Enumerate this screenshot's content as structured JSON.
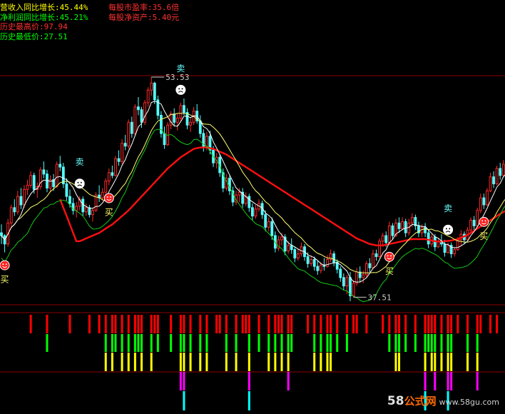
{
  "info_lines": [
    {
      "text": "营收入同比增长:45.44%",
      "color": "#ffff00"
    },
    {
      "text": "净利润同比增长:45.21%",
      "color": "#00ff00"
    },
    {
      "text": "历史最高价:97.94",
      "color": "#ff3030"
    },
    {
      "text": "历史最低价:27.51",
      "color": "#00ff00"
    }
  ],
  "info_right": [
    {
      "text": "每股市盈率:35.6倍",
      "color": "#ff3030"
    },
    {
      "text": "每股净资产:5.40元",
      "color": "#ff3030"
    }
  ],
  "watermark": {
    "num": "58",
    "cn": "公式网",
    "domain": "www.58gu.com"
  },
  "colors": {
    "bg": "#000000",
    "up": "#ff2a2a",
    "down": "#54ffff",
    "ma_red": "#ff1010",
    "ma_yellow": "#ffff6e",
    "ma_white": "#ffffff",
    "ma_green": "#14c814",
    "sep": "#8b0000",
    "bar_red": "#ff0000",
    "bar_green": "#00ff00",
    "bar_yellow": "#ffff00",
    "bar_magenta": "#ff00ff",
    "bar_cyan": "#00ffff"
  },
  "chart_data": {
    "type": "candlestick",
    "price_range": [
      37.51,
      53.53
    ],
    "annotations": [
      {
        "label": "53.53",
        "kind": "high",
        "index": 46
      },
      {
        "label": "37.51",
        "kind": "low",
        "index": 108
      }
    ],
    "signals": [
      {
        "label": "买",
        "type": "buy",
        "index": 1
      },
      {
        "label": "卖",
        "type": "sell",
        "index": 24
      },
      {
        "label": "买",
        "type": "buy",
        "index": 33
      },
      {
        "label": "卖",
        "type": "sell",
        "index": 55
      },
      {
        "label": "买",
        "type": "buy",
        "index": 119
      },
      {
        "label": "卖",
        "type": "sell",
        "index": 137
      },
      {
        "label": "买",
        "type": "buy",
        "index": 148
      }
    ],
    "candles": [
      [
        42.4,
        43.0,
        41.6,
        42.2
      ],
      [
        42.2,
        42.3,
        41.0,
        41.6
      ],
      [
        41.6,
        43.4,
        41.4,
        43.1
      ],
      [
        43.1,
        44.4,
        42.8,
        44.2
      ],
      [
        44.2,
        44.8,
        43.6,
        43.9
      ],
      [
        43.9,
        45.4,
        43.7,
        45.0
      ],
      [
        45.0,
        45.6,
        44.1,
        44.4
      ],
      [
        44.4,
        45.8,
        44.2,
        45.5
      ],
      [
        45.5,
        46.2,
        45.1,
        45.8
      ],
      [
        45.8,
        46.8,
        45.6,
        46.5
      ],
      [
        46.5,
        46.7,
        45.2,
        45.5
      ],
      [
        45.5,
        46.0,
        44.9,
        45.7
      ],
      [
        45.7,
        47.1,
        45.5,
        46.9
      ],
      [
        46.9,
        47.5,
        46.3,
        46.6
      ],
      [
        46.6,
        46.9,
        45.3,
        45.6
      ],
      [
        45.6,
        46.5,
        45.3,
        46.2
      ],
      [
        46.2,
        46.6,
        45.4,
        45.7
      ],
      [
        45.7,
        47.5,
        45.6,
        47.3
      ],
      [
        47.3,
        47.9,
        46.8,
        47.1
      ],
      [
        47.1,
        47.4,
        45.6,
        45.9
      ],
      [
        45.9,
        46.3,
        44.7,
        45.0
      ],
      [
        45.0,
        45.5,
        44.2,
        44.5
      ],
      [
        44.5,
        44.9,
        43.7,
        44.0
      ],
      [
        44.0,
        44.6,
        43.5,
        44.3
      ],
      [
        44.3,
        45.0,
        44.0,
        44.8
      ],
      [
        44.8,
        45.0,
        43.6,
        43.9
      ],
      [
        43.9,
        44.5,
        43.6,
        44.2
      ],
      [
        44.2,
        44.4,
        43.5,
        43.7
      ],
      [
        43.7,
        44.2,
        43.2,
        44.0
      ],
      [
        44.0,
        45.3,
        43.9,
        45.1
      ],
      [
        45.1,
        45.8,
        44.6,
        44.9
      ],
      [
        44.9,
        45.6,
        44.7,
        45.3
      ],
      [
        45.3,
        46.3,
        45.1,
        46.1
      ],
      [
        46.1,
        47.0,
        45.8,
        46.7
      ],
      [
        46.7,
        47.2,
        46.3,
        46.5
      ],
      [
        46.5,
        47.9,
        46.4,
        47.7
      ],
      [
        47.7,
        48.3,
        47.2,
        47.5
      ],
      [
        47.5,
        49.1,
        47.3,
        48.8
      ],
      [
        48.8,
        49.4,
        48.3,
        48.6
      ],
      [
        48.6,
        50.5,
        48.4,
        50.3
      ],
      [
        50.3,
        50.7,
        49.2,
        49.5
      ],
      [
        49.5,
        51.6,
        49.3,
        51.4
      ],
      [
        51.4,
        52.1,
        50.8,
        51.2
      ],
      [
        51.2,
        51.4,
        49.9,
        50.3
      ],
      [
        50.3,
        51.9,
        50.1,
        51.7
      ],
      [
        51.7,
        52.8,
        51.4,
        52.6
      ],
      [
        52.6,
        53.53,
        52.2,
        53.1
      ],
      [
        53.1,
        53.2,
        51.6,
        51.9
      ],
      [
        51.9,
        52.2,
        50.5,
        50.8
      ],
      [
        50.8,
        51.1,
        49.2,
        49.5
      ],
      [
        49.5,
        50.0,
        48.4,
        48.7
      ],
      [
        48.7,
        50.3,
        48.6,
        50.1
      ],
      [
        50.1,
        51.1,
        49.8,
        50.9
      ],
      [
        50.9,
        51.3,
        50.0,
        50.3
      ],
      [
        50.3,
        50.9,
        49.7,
        50.6
      ],
      [
        50.6,
        51.7,
        50.4,
        51.5
      ],
      [
        51.5,
        52.0,
        50.8,
        51.0
      ],
      [
        51.0,
        51.3,
        49.8,
        50.1
      ],
      [
        50.1,
        50.6,
        49.6,
        50.3
      ],
      [
        50.3,
        51.4,
        50.1,
        51.1
      ],
      [
        51.1,
        51.6,
        50.2,
        50.4
      ],
      [
        50.4,
        50.8,
        49.2,
        49.5
      ],
      [
        49.5,
        49.8,
        48.2,
        48.5
      ],
      [
        48.5,
        49.6,
        48.3,
        49.3
      ],
      [
        49.3,
        49.7,
        48.0,
        48.3
      ],
      [
        48.3,
        48.6,
        47.1,
        47.4
      ],
      [
        47.4,
        48.1,
        47.0,
        47.8
      ],
      [
        47.8,
        48.0,
        46.4,
        46.7
      ],
      [
        46.7,
        47.0,
        45.3,
        45.6
      ],
      [
        45.6,
        46.6,
        45.4,
        46.3
      ],
      [
        46.3,
        46.5,
        45.1,
        45.4
      ],
      [
        45.4,
        45.7,
        44.3,
        44.6
      ],
      [
        44.6,
        45.4,
        44.4,
        45.1
      ],
      [
        45.1,
        45.6,
        44.6,
        45.3
      ],
      [
        45.3,
        45.6,
        44.2,
        44.5
      ],
      [
        44.5,
        45.3,
        44.3,
        45.0
      ],
      [
        45.0,
        45.2,
        43.9,
        44.2
      ],
      [
        44.2,
        44.5,
        43.3,
        43.6
      ],
      [
        43.6,
        44.4,
        43.4,
        44.1
      ],
      [
        44.1,
        44.8,
        43.9,
        44.5
      ],
      [
        44.5,
        44.7,
        43.4,
        43.7
      ],
      [
        43.7,
        44.0,
        42.5,
        42.8
      ],
      [
        42.8,
        43.5,
        42.5,
        43.2
      ],
      [
        43.2,
        43.5,
        41.9,
        42.2
      ],
      [
        42.2,
        42.5,
        41.0,
        41.3
      ],
      [
        41.3,
        42.2,
        41.1,
        41.9
      ],
      [
        41.9,
        42.4,
        41.5,
        42.1
      ],
      [
        42.1,
        42.3,
        40.8,
        41.1
      ],
      [
        41.1,
        41.8,
        40.9,
        41.5
      ],
      [
        41.5,
        42.0,
        40.9,
        41.2
      ],
      [
        41.2,
        41.4,
        40.3,
        40.6
      ],
      [
        40.6,
        41.3,
        40.4,
        40.9
      ],
      [
        40.9,
        41.7,
        40.7,
        41.4
      ],
      [
        41.4,
        41.6,
        40.4,
        40.7
      ],
      [
        40.7,
        41.0,
        39.9,
        40.2
      ],
      [
        40.2,
        40.8,
        40.0,
        40.5
      ],
      [
        40.5,
        40.7,
        39.7,
        40.0
      ],
      [
        40.0,
        40.4,
        39.4,
        39.7
      ],
      [
        39.7,
        40.3,
        39.5,
        40.1
      ],
      [
        40.1,
        40.6,
        39.7,
        40.0
      ],
      [
        40.0,
        40.8,
        39.9,
        40.5
      ],
      [
        40.5,
        41.2,
        40.3,
        40.9
      ],
      [
        40.9,
        41.1,
        40.0,
        40.3
      ],
      [
        40.3,
        40.5,
        39.5,
        39.8
      ],
      [
        39.8,
        40.0,
        38.9,
        39.2
      ],
      [
        39.2,
        39.5,
        38.3,
        38.6
      ],
      [
        38.6,
        39.4,
        38.0,
        39.2
      ],
      [
        39.2,
        39.6,
        37.51,
        37.9
      ],
      [
        37.9,
        39.0,
        37.8,
        38.8
      ],
      [
        38.8,
        39.9,
        38.6,
        39.6
      ],
      [
        39.6,
        40.0,
        38.9,
        39.2
      ],
      [
        39.2,
        39.7,
        38.8,
        39.4
      ],
      [
        39.4,
        40.4,
        39.2,
        40.2
      ],
      [
        40.2,
        40.6,
        39.6,
        39.9
      ],
      [
        39.9,
        41.2,
        39.8,
        40.9
      ],
      [
        40.9,
        41.2,
        40.4,
        40.7
      ],
      [
        40.7,
        42.0,
        40.6,
        41.8
      ],
      [
        41.8,
        42.4,
        41.4,
        42.2
      ],
      [
        42.2,
        42.5,
        41.4,
        41.7
      ],
      [
        41.7,
        43.2,
        41.6,
        42.9
      ],
      [
        42.9,
        43.1,
        41.9,
        42.2
      ],
      [
        42.2,
        43.4,
        42.1,
        43.1
      ],
      [
        43.1,
        43.5,
        42.4,
        42.7
      ],
      [
        42.7,
        43.5,
        42.6,
        43.2
      ],
      [
        43.2,
        43.4,
        42.1,
        42.4
      ],
      [
        42.4,
        43.4,
        42.2,
        43.1
      ],
      [
        43.1,
        43.8,
        42.8,
        43.5
      ],
      [
        43.5,
        43.7,
        42.6,
        42.9
      ],
      [
        42.9,
        43.2,
        42.1,
        42.4
      ],
      [
        42.4,
        43.0,
        42.1,
        42.8
      ],
      [
        42.8,
        43.1,
        42.1,
        42.4
      ],
      [
        42.4,
        42.6,
        41.3,
        41.6
      ],
      [
        41.6,
        42.3,
        41.4,
        42.1
      ],
      [
        42.1,
        42.3,
        41.1,
        41.4
      ],
      [
        41.4,
        42.0,
        41.3,
        41.8
      ],
      [
        41.8,
        42.3,
        41.4,
        41.6
      ],
      [
        41.6,
        41.9,
        40.7,
        41.0
      ],
      [
        41.0,
        41.7,
        40.9,
        41.5
      ],
      [
        41.5,
        41.7,
        40.6,
        40.9
      ],
      [
        40.9,
        41.4,
        40.7,
        41.2
      ],
      [
        41.2,
        42.1,
        41.1,
        41.9
      ],
      [
        41.9,
        42.6,
        41.5,
        42.3
      ],
      [
        42.3,
        42.5,
        41.6,
        41.9
      ],
      [
        41.9,
        42.8,
        41.8,
        42.6
      ],
      [
        42.6,
        43.5,
        42.4,
        43.3
      ],
      [
        43.3,
        43.6,
        42.6,
        42.9
      ],
      [
        42.9,
        44.2,
        42.8,
        44.0
      ],
      [
        44.0,
        45.2,
        43.8,
        44.9
      ],
      [
        44.9,
        45.2,
        44.1,
        44.4
      ],
      [
        44.4,
        45.6,
        44.3,
        45.4
      ],
      [
        45.4,
        46.7,
        45.3,
        46.4
      ],
      [
        46.4,
        46.8,
        45.6,
        45.9
      ],
      [
        45.9,
        47.2,
        45.8,
        47.0
      ],
      [
        47.0,
        47.4,
        46.2,
        46.5
      ],
      [
        46.5,
        47.6,
        46.4,
        47.3
      ],
      [
        47.3,
        47.5,
        46.4,
        46.7
      ],
      [
        46.7,
        47.4,
        46.1,
        47.1
      ]
    ],
    "ma_lines": [
      {
        "name": "",
        "color": "#ff1010",
        "start": 18,
        "values": [
          44.8,
          44.2,
          43.6,
          43.0,
          42.4,
          41.8,
          41.8,
          41.9,
          42.0,
          42.1,
          42.2,
          42.3,
          42.4,
          42.55,
          42.7,
          42.85,
          43.0,
          43.2,
          43.4,
          43.6,
          43.8,
          44.0,
          44.25,
          44.5,
          44.75,
          45.0,
          45.25,
          45.5,
          45.75,
          46.0,
          46.25,
          46.5,
          46.75,
          47.0,
          47.2,
          47.4,
          47.6,
          47.8,
          47.95,
          48.1,
          48.25,
          48.4,
          48.45,
          48.5,
          48.5,
          48.5,
          48.45,
          48.4,
          48.3,
          48.2,
          48.1,
          48.0,
          47.85,
          47.7,
          47.55,
          47.4,
          47.25,
          47.1,
          46.95,
          46.8,
          46.65,
          46.5,
          46.35,
          46.2,
          46.05,
          45.9,
          45.75,
          45.6,
          45.45,
          45.3,
          45.15,
          45.0,
          44.85,
          44.7,
          44.55,
          44.4,
          44.25,
          44.1,
          43.95,
          43.8,
          43.65,
          43.5,
          43.35,
          43.2,
          43.05,
          42.9,
          42.75,
          42.6,
          42.45,
          42.3,
          42.15,
          42.0,
          41.9,
          41.8,
          41.7,
          41.6,
          41.55,
          41.5,
          41.5,
          41.5,
          41.55,
          41.6,
          41.65,
          41.7,
          41.75,
          41.8,
          41.85,
          41.9,
          41.95,
          41.95,
          41.95,
          41.95,
          41.95,
          41.9,
          41.85,
          41.8,
          41.78,
          41.78,
          41.8,
          41.82,
          41.85,
          41.9,
          41.95,
          42.05,
          42.15,
          42.25,
          42.4,
          42.55,
          42.7,
          42.85,
          43.0,
          43.15,
          43.3,
          43.45,
          43.6,
          43.75,
          43.9,
          44.0
        ]
      },
      {
        "name": "",
        "color": "#ffff6e",
        "start": 0,
        "smooth": 14
      },
      {
        "name": "",
        "color": "#ffffff",
        "start": 0,
        "smooth": 6
      },
      {
        "name": "",
        "color": "#14c814",
        "start": 0,
        "smooth": 9,
        "offset": -1.6
      }
    ],
    "indicator": {
      "levels": [
        "bar_red",
        "bar_green",
        "bar_yellow",
        "bar_magenta",
        "bar_cyan"
      ],
      "columns": [
        [
          9,
          1
        ],
        [
          14,
          2
        ],
        [
          21,
          1
        ],
        [
          27,
          1
        ],
        [
          30,
          1
        ],
        [
          32,
          3
        ],
        [
          34,
          3
        ],
        [
          35,
          2
        ],
        [
          37,
          3
        ],
        [
          39,
          3
        ],
        [
          41,
          3
        ],
        [
          42,
          2
        ],
        [
          43,
          3
        ],
        [
          46,
          3
        ],
        [
          47,
          1
        ],
        [
          48,
          2
        ],
        [
          52,
          2
        ],
        [
          55,
          4
        ],
        [
          56,
          5
        ],
        [
          58,
          3
        ],
        [
          61,
          3
        ],
        [
          63,
          3
        ],
        [
          66,
          1
        ],
        [
          67,
          1
        ],
        [
          69,
          3
        ],
        [
          72,
          3
        ],
        [
          74,
          1
        ],
        [
          75,
          1
        ],
        [
          76,
          5
        ],
        [
          79,
          2
        ],
        [
          82,
          3
        ],
        [
          84,
          3
        ],
        [
          85,
          1
        ],
        [
          86,
          3
        ],
        [
          88,
          4
        ],
        [
          89,
          2
        ],
        [
          94,
          1
        ],
        [
          96,
          3
        ],
        [
          98,
          3
        ],
        [
          100,
          3
        ],
        [
          101,
          3
        ],
        [
          103,
          2
        ],
        [
          106,
          2
        ],
        [
          108,
          1
        ],
        [
          109,
          1
        ],
        [
          112,
          1
        ],
        [
          117,
          1
        ],
        [
          119,
          2
        ],
        [
          121,
          3
        ],
        [
          122,
          3
        ],
        [
          124,
          2
        ],
        [
          127,
          2
        ],
        [
          130,
          5
        ],
        [
          131,
          2
        ],
        [
          132,
          3
        ],
        [
          133,
          4
        ],
        [
          135,
          3
        ],
        [
          137,
          5
        ],
        [
          138,
          4
        ],
        [
          140,
          1
        ],
        [
          143,
          3
        ],
        [
          146,
          4
        ],
        [
          147,
          1
        ],
        [
          150,
          1
        ],
        [
          152,
          1
        ]
      ]
    }
  }
}
